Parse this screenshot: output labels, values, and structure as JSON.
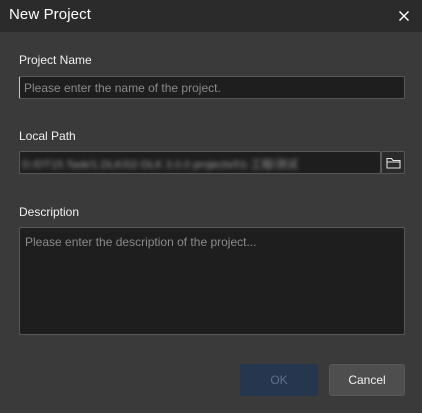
{
  "dialog": {
    "title": "New Project"
  },
  "fields": {
    "project_name": {
      "label": "Project Name",
      "value": "",
      "placeholder": "Please enter the name of the project."
    },
    "local_path": {
      "label": "Local Path",
      "value": "D:/DT15.Task/1.DLK/02-DLK 3.0.0 projects/01-工程/测试"
    },
    "description": {
      "label": "Description",
      "value": "",
      "placeholder": "Please enter the description of the project..."
    }
  },
  "buttons": {
    "ok": "OK",
    "cancel": "Cancel"
  },
  "icons": {
    "close": "close-icon",
    "browse": "folder-icon"
  },
  "colors": {
    "titlebar": "#2b2b2b",
    "background": "#3a3a3a",
    "ok_disabled": "#27364f",
    "cancel": "#4e4e4e"
  }
}
